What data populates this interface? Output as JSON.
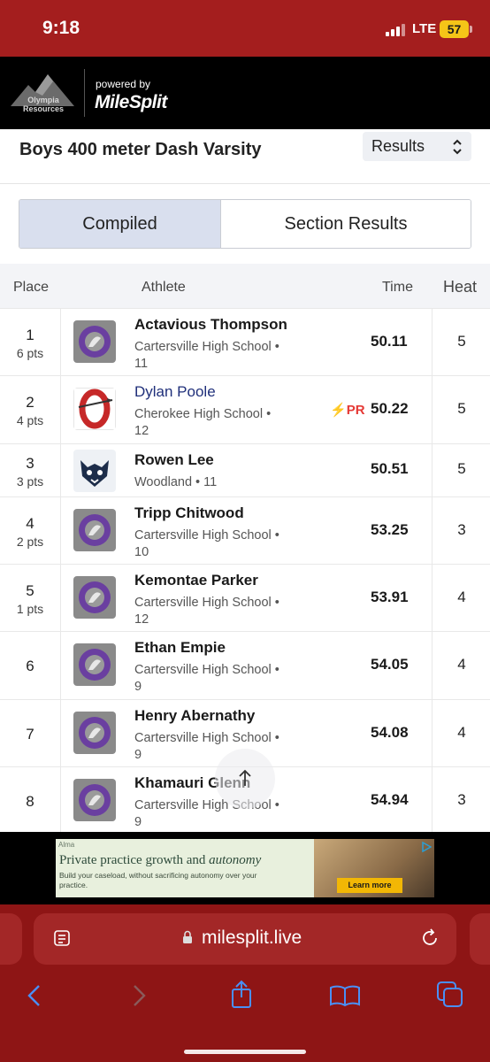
{
  "status_bar": {
    "time": "9:18",
    "network": "LTE",
    "battery": "57"
  },
  "header": {
    "brand_line1": "Olympia",
    "brand_line2": "Resources",
    "powered_by": "powered by",
    "milesplit": "MileSplit"
  },
  "event": {
    "title": "Boys 400 meter Dash Varsity",
    "view_select": "Results"
  },
  "tabs": [
    {
      "label": "Compiled",
      "active": true
    },
    {
      "label": "Section Results",
      "active": false
    }
  ],
  "table": {
    "columns": {
      "place": "Place",
      "athlete": "Athlete",
      "time": "Time",
      "heat": "Heat"
    },
    "rows": [
      {
        "place": "1",
        "pts": "6 pts",
        "name": "Actavious Thompson",
        "school_line1": "Cartersville High School •",
        "school_line2": "11",
        "time": "50.11",
        "heat": "5",
        "logo": "cartersville-logo"
      },
      {
        "place": "2",
        "pts": "4 pts",
        "name": "Dylan Poole",
        "school_line1": "Cherokee High School •",
        "school_line2": "12",
        "time": "50.22",
        "heat": "5",
        "pr": "PR",
        "logo": "cherokee-logo"
      },
      {
        "place": "3",
        "pts": "3 pts",
        "name": "Rowen Lee",
        "school_line1": "Woodland • 11",
        "school_line2": "",
        "time": "50.51",
        "heat": "5",
        "logo": "woodland-logo"
      },
      {
        "place": "4",
        "pts": "2 pts",
        "name": "Tripp Chitwood",
        "school_line1": "Cartersville High School •",
        "school_line2": "10",
        "time": "53.25",
        "heat": "3",
        "logo": "cartersville-logo"
      },
      {
        "place": "5",
        "pts": "1 pts",
        "name": "Kemontae Parker",
        "school_line1": "Cartersville High School •",
        "school_line2": "12",
        "time": "53.91",
        "heat": "4",
        "logo": "cartersville-logo"
      },
      {
        "place": "6",
        "pts": "",
        "name": "Ethan Empie",
        "school_line1": "Cartersville High School •",
        "school_line2": "9",
        "time": "54.05",
        "heat": "4",
        "logo": "cartersville-logo"
      },
      {
        "place": "7",
        "pts": "",
        "name": "Henry Abernathy",
        "school_line1": "Cartersville High School •",
        "school_line2": "9",
        "time": "54.08",
        "heat": "4",
        "logo": "cartersville-logo"
      },
      {
        "place": "8",
        "pts": "",
        "name": "Khamauri Glenn",
        "school_line1": "Cartersville High School •",
        "school_line2": "9",
        "time": "54.94",
        "heat": "3",
        "logo": "cartersville-logo"
      }
    ]
  },
  "ad": {
    "brand": "Alma",
    "headline_plain": "Private practice growth and ",
    "headline_italic": "autonomy",
    "body": "Build your caseload, without sacrificing autonomy over your practice.",
    "cta": "Learn more"
  },
  "browser": {
    "url": "milesplit.live"
  },
  "colors": {
    "status_bar": "#a41e1e",
    "browser_chrome": "#8e1515",
    "tab_active": "#d9dfee",
    "link": "#1f2f7a",
    "pr": "#e53935"
  }
}
